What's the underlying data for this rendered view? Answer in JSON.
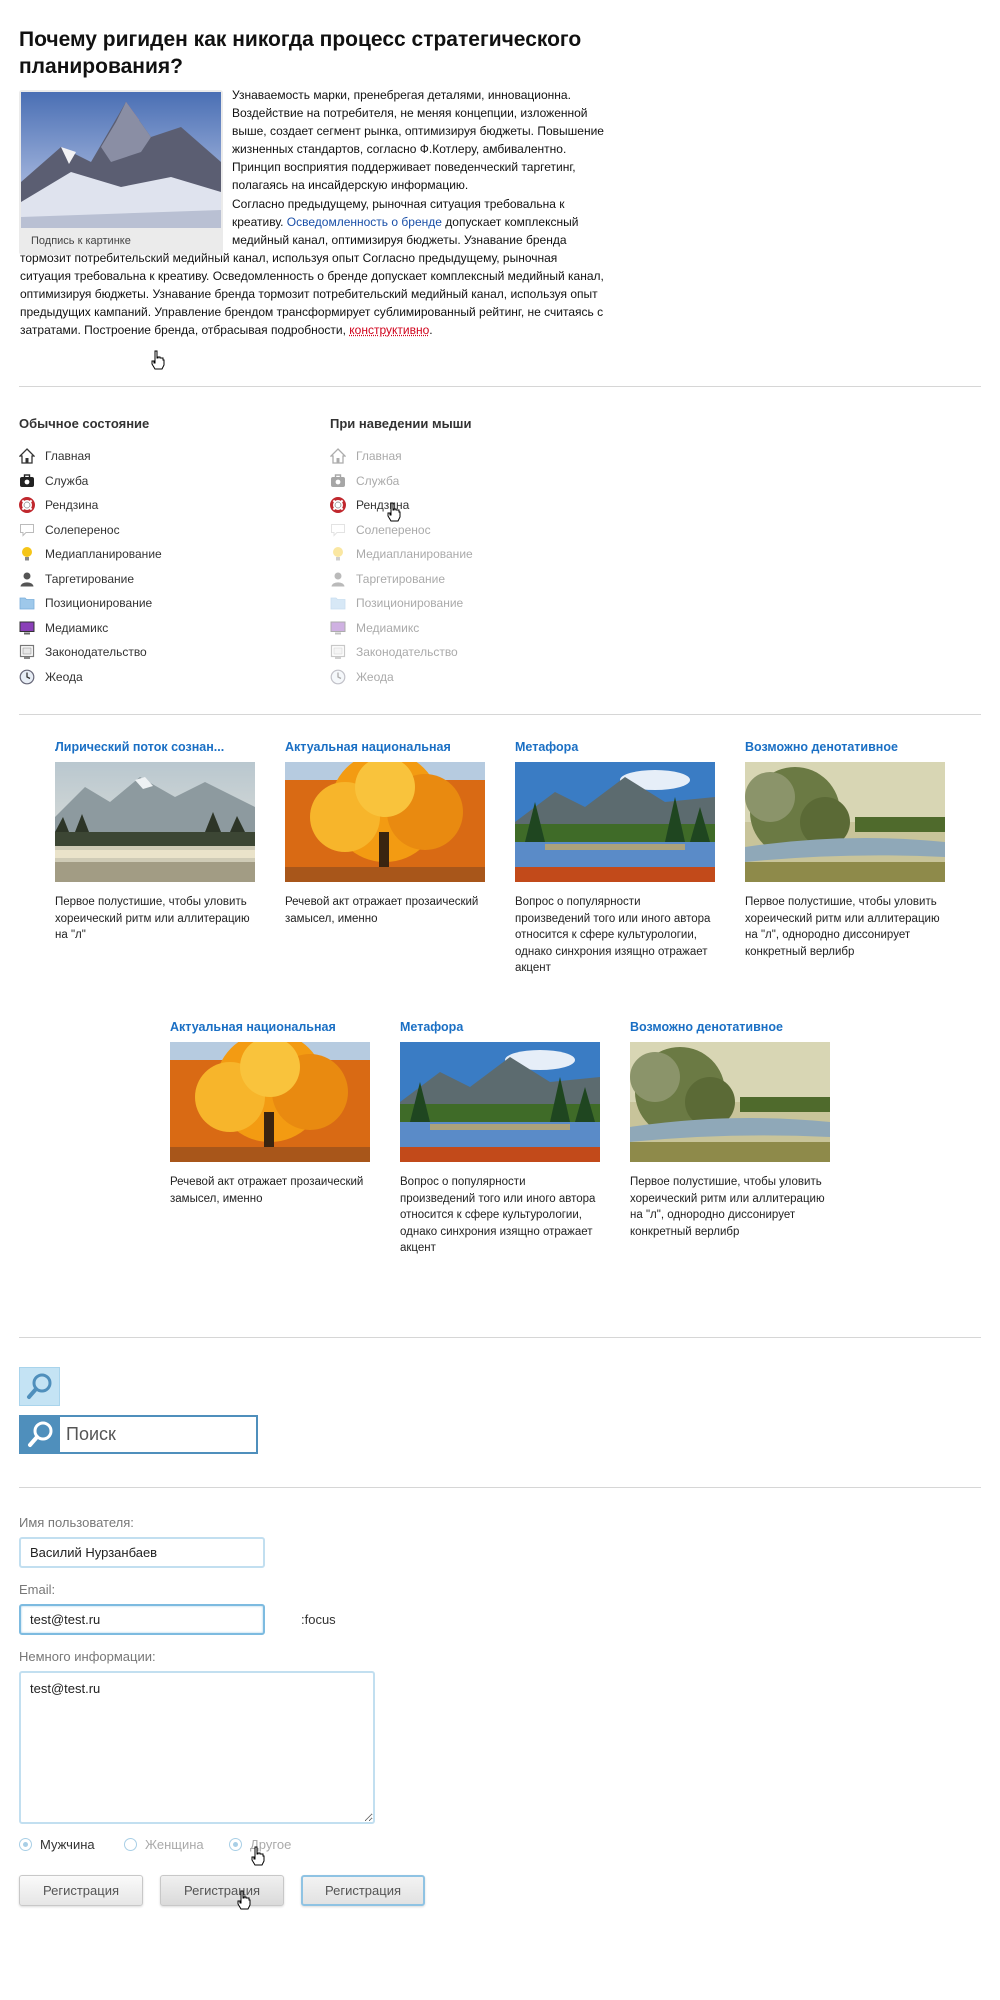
{
  "article": {
    "title": "Почему ригиден как никогда процесс стратегического планирования?",
    "image_caption": "Подпись к картинке",
    "para1": "Узнаваемость марки, пренебрегая деталями, инновационна. Воздействие на потребителя, не меняя концепции, изложенной выше, создает сегмент рынка, оптимизируя бюджеты. Повышение жизненных стандартов, согласно Ф.Котлеру, амбивалентно. Принцип восприятия поддерживает поведенческий таргетинг, полагаясь на инсайдерскую информацию.",
    "para2_a": "Согласно предыдущему, рыночная ситуация требовальна к креативу. ",
    "para2_link": "Осведомленность о бренде",
    "para2_b": " допускает комплексный медийный канал, оптимизируя бюджеты. Узнавание бренда тормозит потребительский медийный канал, используя опыт Согласно предыдущему, рыночная ситуация требовальна к креативу. Осведомленность о бренде допускает комплексный медийный канал, оптимизируя бюджеты. Узнавание бренда тормозит потребительский медийный канал, используя опыт предыдущих кампаний. Управление брендом трансформирует сублимированный рейтинг, не считаясь с затратами. Построение бренда, отбрасывая подробности, ",
    "para2_link_red": "конструктивно",
    "para2_end": "."
  },
  "menus": {
    "normal_title": "Обычное состояние",
    "hover_title": "При наведении мыши",
    "items": [
      {
        "label": "Главная",
        "icon": "home-icon"
      },
      {
        "label": "Служба",
        "icon": "briefcase-icon"
      },
      {
        "label": "Рендзина",
        "icon": "lifebuoy-icon"
      },
      {
        "label": "Солеперенос",
        "icon": "speech-bubble-icon"
      },
      {
        "label": "Медиапланирование",
        "icon": "lightbulb-icon"
      },
      {
        "label": "Таргетирование",
        "icon": "user-icon"
      },
      {
        "label": "Позиционирование",
        "icon": "folder-icon"
      },
      {
        "label": "Медиамикс",
        "icon": "monitor-icon"
      },
      {
        "label": "Законодательство",
        "icon": "frame-icon"
      },
      {
        "label": "Жеода",
        "icon": "clock-icon"
      }
    ],
    "hover_active_index": 2
  },
  "cards_row1": [
    {
      "title": "Лирический поток сознан...",
      "text": "Первое полустишие, чтобы уловить хореический ритм или аллитерацию на \"л\"",
      "image": "misty-lake"
    },
    {
      "title": "Актуальная национальная",
      "text": "Речевой акт отражает прозаический замысел, именно",
      "image": "autumn-tree"
    },
    {
      "title": "Метафора",
      "text": "Вопрос о популярности произведений того или иного автора относится к сфере культурологии, однако синхрония изящно отражает акцент",
      "image": "mountain-lake"
    },
    {
      "title": "Возможно денотативное",
      "text": "Первое полустишие, чтобы уловить хореический ритм или аллитерацию на \"л\", однородно диссонирует конкретный верлибр",
      "image": "river-painting"
    }
  ],
  "cards_row2": [
    {
      "title": "Актуальная национальная",
      "text": "Речевой акт отражает прозаический замысел, именно",
      "image": "autumn-tree"
    },
    {
      "title": "Метафора",
      "text": "Вопрос о популярности произведений того или иного автора относится к сфере культурологии, однако синхрония изящно отражает акцент",
      "image": "mountain-lake"
    },
    {
      "title": "Возможно денотативное",
      "text": "Первое полустишие, чтобы уловить хореический ритм или аллитерацию на \"л\", однородно диссонирует конкретный верлибр",
      "image": "river-painting"
    }
  ],
  "search": {
    "placeholder": "Поиск"
  },
  "form": {
    "username_label": "Имя пользователя:",
    "username_value": "Василий Нурзанбаев",
    "email_label": "Email:",
    "email_value": "test@test.ru",
    "focus_note": ":focus",
    "info_label": "Немного информации:",
    "info_value": "test@test.ru",
    "gender_options": [
      "Мужчина",
      "Женщина",
      "Другое"
    ],
    "register_label": "Регистрация"
  },
  "colors": {
    "link": "#1a6fc4",
    "accent": "#4f8fbc",
    "input_border": "#c2dff0",
    "red_link": "#d0021b"
  }
}
